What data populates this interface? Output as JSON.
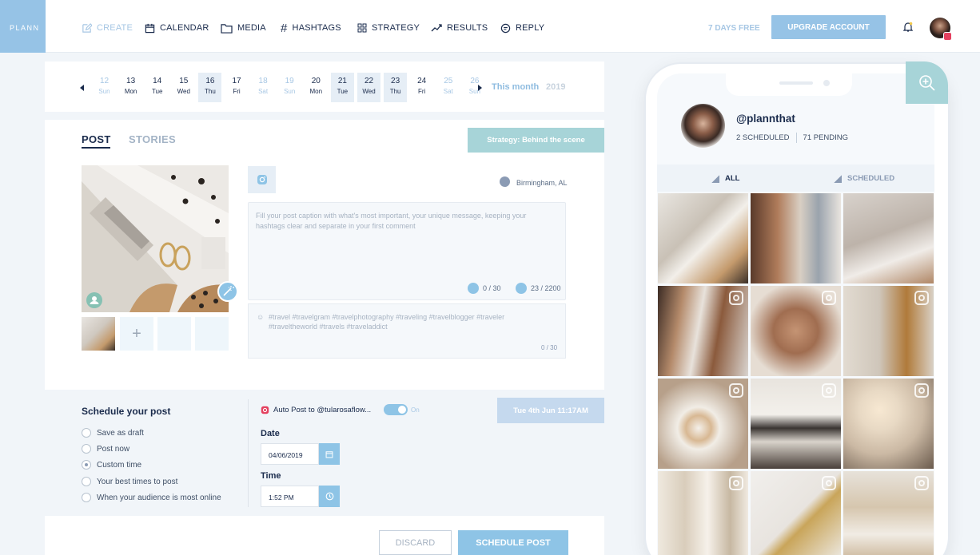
{
  "app": {
    "logo": "PLANN",
    "nav": [
      {
        "label": "CREATE",
        "icon": "edit-icon"
      },
      {
        "label": "CALENDAR",
        "icon": "calendar-icon"
      },
      {
        "label": "MEDIA",
        "icon": "folder-icon"
      },
      {
        "label": "HASHTAGS",
        "icon": "hashtag-icon"
      },
      {
        "label": "STRATEGY",
        "icon": "grid-icon"
      },
      {
        "label": "RESULTS",
        "icon": "trend-icon"
      },
      {
        "label": "REPLY",
        "icon": "chat-icon"
      }
    ],
    "trial": "7 DAYS FREE",
    "upgrade": "UPGRADE ACCOUNT"
  },
  "dates": {
    "days": [
      {
        "d": "12",
        "w": "Sun",
        "weekend": true,
        "sel": false
      },
      {
        "d": "13",
        "w": "Mon",
        "weekend": false,
        "sel": false
      },
      {
        "d": "14",
        "w": "Tue",
        "weekend": false,
        "sel": false
      },
      {
        "d": "15",
        "w": "Wed",
        "weekend": false,
        "sel": false
      },
      {
        "d": "16",
        "w": "Thu",
        "weekend": false,
        "sel": true
      },
      {
        "d": "17",
        "w": "Fri",
        "weekend": false,
        "sel": false
      },
      {
        "d": "18",
        "w": "Sat",
        "weekend": true,
        "sel": false
      },
      {
        "d": "19",
        "w": "Sun",
        "weekend": true,
        "sel": false
      },
      {
        "d": "20",
        "w": "Mon",
        "weekend": false,
        "sel": false
      },
      {
        "d": "21",
        "w": "Tue",
        "weekend": false,
        "sel": true
      },
      {
        "d": "22",
        "w": "Wed",
        "weekend": false,
        "sel": true
      },
      {
        "d": "23",
        "w": "Thu",
        "weekend": false,
        "sel": true
      },
      {
        "d": "24",
        "w": "Fri",
        "weekend": false,
        "sel": false
      },
      {
        "d": "25",
        "w": "Sat",
        "weekend": true,
        "sel": false
      },
      {
        "d": "26",
        "w": "Sun",
        "weekend": true,
        "sel": false
      }
    ],
    "this_month": "This month",
    "year": "2019"
  },
  "post": {
    "tab_post": "POST",
    "tab_stories": "STORIES",
    "strategy": "Strategy: Behind the scene",
    "location": "Birmingham, AL",
    "caption_placeholder": "Fill your post caption with what's most important, your unique message, keeping your hashtags clear and separate in your first comment",
    "hashtag_count": "0 / 30",
    "char_count": "23 / 2200",
    "hashtags": "#travel #travelgram #travelphotography #traveling #travelblogger #traveler #traveltheworld #travels #traveladdict",
    "hashtags_box_count": "0 / 30",
    "add_symbol": "+"
  },
  "schedule": {
    "title": "Schedule your post",
    "options": [
      {
        "label": "Save as draft",
        "checked": false
      },
      {
        "label": "Post now",
        "checked": false
      },
      {
        "label": "Custom time",
        "checked": true
      },
      {
        "label": "Your best times to post",
        "checked": false
      },
      {
        "label": "When your audience is most online",
        "checked": false
      }
    ],
    "autopost": "Auto Post to @tularosaflow...",
    "toggle_state": "On",
    "datetime_label": "Tue 4th Jun   11:17AM",
    "date_label": "Date",
    "date_value": "04/06/2019",
    "time_label": "Time",
    "time_value": "1:52 PM",
    "discard": "DISCARD",
    "schedule_btn": "SCHEDULE POST"
  },
  "phone": {
    "handle": "@plannthat",
    "scheduled": "2 SCHEDULED",
    "pending": "71 PENDING",
    "tab_all": "ALL",
    "tab_scheduled": "SCHEDULED",
    "grid": [
      {
        "name": "desk-flatlay",
        "bg": "linear-gradient(135deg,#e9e6e1 0%,#c9c1b6 40%,#f2efea 55%,#c49a6c 80%,#3a2f28 100%)",
        "ig": false
      },
      {
        "name": "clothes-rack",
        "bg": "linear-gradient(90deg,#5a3a2a 0%,#b07c5b 30%,#d9cfc3 55%,#9aa3ad 75%,#e9e4de 100%)",
        "ig": false
      },
      {
        "name": "knit-blanket",
        "bg": "linear-gradient(160deg,#d8d2cc 0%,#bdb3aa 45%,#f0ece8 70%,#b08766 100%)",
        "ig": false
      },
      {
        "name": "hanging-shirts",
        "bg": "linear-gradient(100deg,#3b2b24 0%,#b48a6a 25%,#e8e2db 45%,#8b5a3c 65%,#d9d4cf 100%)",
        "ig": true
      },
      {
        "name": "gold-necklaces",
        "bg": "radial-gradient(circle at 50% 50%,#c59474 0,#a06d50 35%,#e6ddd3 75%)",
        "ig": true
      },
      {
        "name": "beige-coat",
        "bg": "linear-gradient(90deg,#e2dbd1 0%,#cfc6ba 40%,#b07a3a 70%,#d9d1c6 100%)",
        "ig": true
      },
      {
        "name": "latte-art",
        "bg": "radial-gradient(circle at 45% 55%,#f4f0ea 0,#d8b893 18%,#f1ede6 30%,#b7a08a 70%)",
        "ig": true
      },
      {
        "name": "picture-frame",
        "bg": "linear-gradient(180deg,#e8e4de 0%,#f3f0eb 40%,#3a3532 55%,#d9d3cb 70%,#4a403a 100%)",
        "ig": true
      },
      {
        "name": "candle-cups",
        "bg": "radial-gradient(circle at 40% 35%,#f7e8d2 0,#e8d9c4 25%,#cbb9a4 55%,#6a5a4c 100%)",
        "ig": true
      },
      {
        "name": "curtains",
        "bg": "linear-gradient(90deg,#efe9df 0%,#d9cdbb 30%,#f6f1ea 55%,#c7b8a2 80%,#f0eae1 100%)",
        "ig": true
      },
      {
        "name": "gold-earrings",
        "bg": "linear-gradient(135deg,#f1efec 0%,#e8e4df 50%,#c9a55a 60%,#eeebe6 100%)",
        "ig": true
      },
      {
        "name": "dried-flowers",
        "bg": "linear-gradient(180deg,#e7e2da 0%,#d6c6ae 40%,#f1ece4 70%,#c9b395 100%)",
        "ig": true
      }
    ]
  },
  "colors": {
    "accent": "#8ec4e6",
    "teal": "#a7d4d8",
    "navy": "#1a2b4c"
  }
}
